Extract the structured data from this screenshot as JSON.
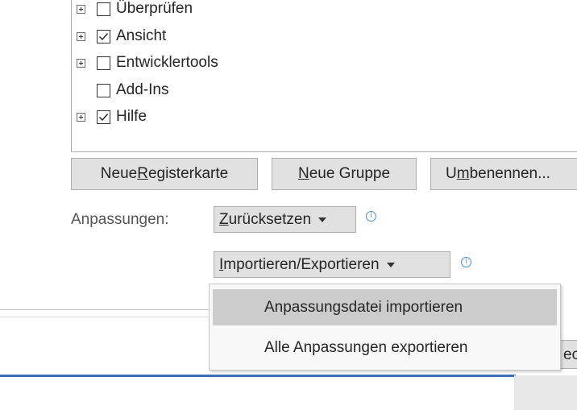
{
  "tree": {
    "items": [
      {
        "label": "Überprüfen",
        "checked": false,
        "expander": true
      },
      {
        "label": "Ansicht",
        "checked": true,
        "expander": true
      },
      {
        "label": "Entwicklertools",
        "checked": false,
        "expander": true
      },
      {
        "label": "Add-Ins",
        "checked": false,
        "expander": false
      },
      {
        "label": "Hilfe",
        "checked": true,
        "expander": true
      }
    ]
  },
  "buttons": {
    "new_tab": {
      "pre": "Neue ",
      "accel": "R",
      "post": "egisterkarte"
    },
    "new_group": {
      "pre": "",
      "accel": "N",
      "post": "eue Gruppe"
    },
    "rename": {
      "pre": "U",
      "accel": "m",
      "post": "benennen..."
    }
  },
  "customizations": {
    "label": "Anpassungen:",
    "reset": {
      "pre": "",
      "accel": "Z",
      "post": "urücksetzen"
    },
    "import_export": {
      "pre": "",
      "accel": "I",
      "post": "mportieren/Exportieren"
    },
    "info_glyph": "i"
  },
  "menu": {
    "items": [
      {
        "label": "Anpassungsdatei importieren",
        "highlighted": true
      },
      {
        "label": "Alle Anpassungen exportieren",
        "highlighted": false
      }
    ]
  },
  "background": {
    "partial_button_text": "ec"
  },
  "colors": {
    "accent_blue": "#3f6fb3",
    "info_icon": "#4f8bd6",
    "menu_highlight": "#cccccc",
    "button_face": "#e1e1e1"
  }
}
